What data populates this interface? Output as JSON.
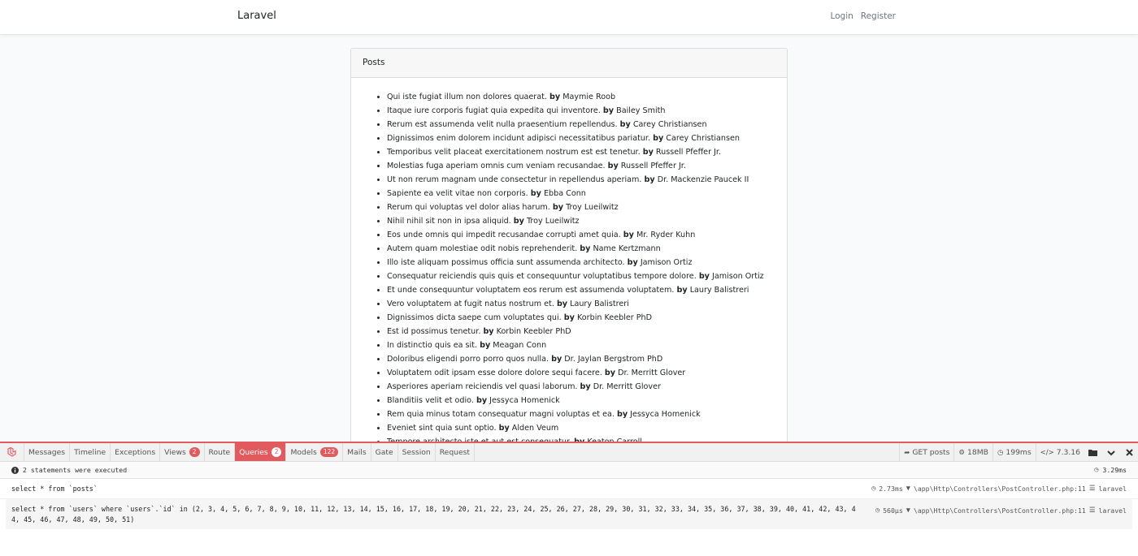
{
  "navbar": {
    "brand": "Laravel",
    "login": "Login",
    "register": "Register"
  },
  "card": {
    "header": "Posts",
    "posts": [
      {
        "title": "Qui iste fugiat illum non dolores quaerat.",
        "by": "by",
        "author": "Maymie Roob"
      },
      {
        "title": "Itaque iure corporis fugiat quia expedita qui inventore.",
        "by": "by",
        "author": "Bailey Smith"
      },
      {
        "title": "Rerum est assumenda velit nulla praesentium repellendus.",
        "by": "by",
        "author": "Carey Christiansen"
      },
      {
        "title": "Dignissimos enim dolorem incidunt adipisci necessitatibus pariatur.",
        "by": "by",
        "author": "Carey Christiansen"
      },
      {
        "title": "Temporibus velit placeat exercitationem nostrum est est tenetur.",
        "by": "by",
        "author": "Russell Pfeffer Jr."
      },
      {
        "title": "Molestias fuga aperiam omnis cum veniam recusandae.",
        "by": "by",
        "author": "Russell Pfeffer Jr."
      },
      {
        "title": "Ut non rerum magnam unde consectetur in repellendus aperiam.",
        "by": "by",
        "author": "Dr. Mackenzie Paucek II"
      },
      {
        "title": "Sapiente ea velit vitae non corporis.",
        "by": "by",
        "author": "Ebba Conn"
      },
      {
        "title": "Rerum qui voluptas vel dolor alias harum.",
        "by": "by",
        "author": "Troy Lueilwitz"
      },
      {
        "title": "Nihil nihil sit non in ipsa aliquid.",
        "by": "by",
        "author": "Troy Lueilwitz"
      },
      {
        "title": "Eos unde omnis qui impedit recusandae corrupti amet quia.",
        "by": "by",
        "author": "Mr. Ryder Kuhn"
      },
      {
        "title": "Autem quam molestiae odit nobis reprehenderit.",
        "by": "by",
        "author": "Name Kertzmann"
      },
      {
        "title": "Illo iste aliquam possimus officia sunt assumenda architecto.",
        "by": "by",
        "author": "Jamison Ortiz"
      },
      {
        "title": "Consequatur reiciendis quis quis et consequuntur voluptatibus tempore dolore.",
        "by": "by",
        "author": "Jamison Ortiz"
      },
      {
        "title": "Et unde consequuntur voluptatem eos rerum est assumenda voluptatem.",
        "by": "by",
        "author": "Laury Balistreri"
      },
      {
        "title": "Vero voluptatem at fugit natus nostrum et.",
        "by": "by",
        "author": "Laury Balistreri"
      },
      {
        "title": "Dignissimos dicta saepe cum voluptates qui.",
        "by": "by",
        "author": "Korbin Keebler PhD"
      },
      {
        "title": "Est id possimus tenetur.",
        "by": "by",
        "author": "Korbin Keebler PhD"
      },
      {
        "title": "In distinctio quis ea sit.",
        "by": "by",
        "author": "Meagan Conn"
      },
      {
        "title": "Doloribus eligendi porro porro quos nulla.",
        "by": "by",
        "author": "Dr. Jaylan Bergstrom PhD"
      },
      {
        "title": "Voluptatem odit ipsam esse dolore dolore sequi facere.",
        "by": "by",
        "author": "Dr. Merritt Glover"
      },
      {
        "title": "Asperiores aperiam reiciendis vel quasi laborum.",
        "by": "by",
        "author": "Dr. Merritt Glover"
      },
      {
        "title": "Blanditiis velit et odio.",
        "by": "by",
        "author": "Jessyca Homenick"
      },
      {
        "title": "Rem quia minus totam consequatur magni voluptas et ea.",
        "by": "by",
        "author": "Jessyca Homenick"
      },
      {
        "title": "Eveniet sint quia sunt optio.",
        "by": "by",
        "author": "Alden Veum"
      },
      {
        "title": "Tempore architecto iste et aut est consequatur.",
        "by": "by",
        "author": "Keaton Carroll"
      }
    ]
  },
  "debugbar": {
    "tabs": [
      {
        "label": "Messages"
      },
      {
        "label": "Timeline"
      },
      {
        "label": "Exceptions"
      },
      {
        "label": "Views",
        "badge": "2"
      },
      {
        "label": "Route"
      },
      {
        "label": "Queries",
        "badge": "2",
        "active": true
      },
      {
        "label": "Models",
        "badge": "122"
      },
      {
        "label": "Mails"
      },
      {
        "label": "Gate"
      },
      {
        "label": "Session"
      },
      {
        "label": "Request"
      }
    ],
    "indicators": {
      "route": "GET posts",
      "memory": "18MB",
      "time": "199ms",
      "php_version": "7.3.16"
    },
    "status": {
      "text": "2 statements were executed",
      "total_time": "3.29ms"
    },
    "statements": [
      {
        "sql": "select * from `posts`",
        "duration": "2.73ms",
        "source": "\\app\\Http\\Controllers\\PostController.php:11",
        "connection": "laravel"
      },
      {
        "sql": "select * from `users` where `users`.`id` in (2, 3, 4, 5, 6, 7, 8, 9, 10, 11, 12, 13, 14, 15, 16, 17, 18, 19, 20, 21, 22, 23, 24, 25, 26, 27, 28, 29, 30, 31, 32, 33, 34, 35, 36, 37, 38, 39, 40, 41, 42, 43, 44, 45, 46, 47, 48, 49, 50, 51)",
        "duration": "560μs",
        "source": "\\app\\Http\\Controllers\\PostController.php:11",
        "connection": "laravel"
      }
    ],
    "icons": {
      "logo": "laravel-logo-icon",
      "route": "share-icon",
      "memory": "cogs-icon",
      "time": "clock-icon",
      "php": "code-icon",
      "open": "folder-icon",
      "minimize": "chevron-down-icon",
      "close": "close-icon",
      "info": "info-icon",
      "db": "database-icon",
      "pin": "thumbtack-icon"
    },
    "accent": "#e05a5e"
  }
}
